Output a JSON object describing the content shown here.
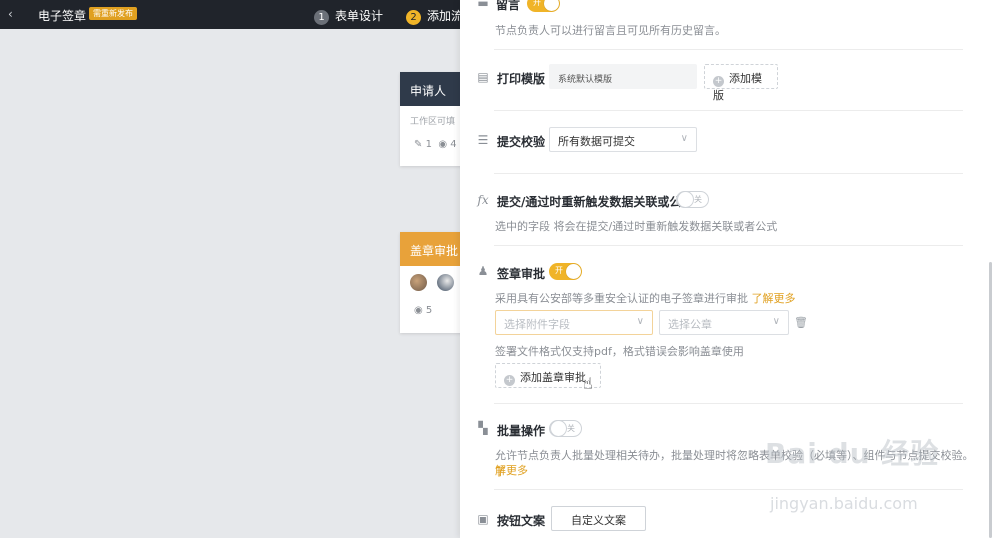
{
  "topbar": {
    "back_icon": "chevron-left-icon",
    "app_title": "电子签章",
    "badge": "需重新发布",
    "steps": [
      {
        "num": "1",
        "label": "表单设计"
      },
      {
        "num": "2",
        "label": "添加流"
      }
    ]
  },
  "canvas": {
    "applicant_node": {
      "title": "申请人",
      "subtitle": "工作区可填",
      "edit_count": "1",
      "view_count": "4"
    },
    "seal_node": {
      "title": "盖章审批",
      "view_count": "5"
    }
  },
  "panel": {
    "comment": {
      "title": "留言",
      "toggle": "开",
      "desc": "节点负责人可以进行留言且可见所有历史留言。"
    },
    "print": {
      "title": "打印模版",
      "template_value": "系统默认模版",
      "add_label": "添加模版"
    },
    "submit_check": {
      "title": "提交校验",
      "select_value": "所有数据可提交"
    },
    "retrigger": {
      "icon_text": "fx",
      "title": "提交/通过时重新触发数据关联或公式",
      "toggle": "关",
      "desc": "选中的字段 将会在提交/通过时重新触发数据关联或者公式"
    },
    "seal": {
      "title": "签章审批",
      "toggle": "开",
      "desc": "采用具有公安部等多重安全认证的电子签章进行审批",
      "learn_more": "了解更多",
      "attachment_placeholder": "选择附件字段",
      "seal_placeholder": "选择公章",
      "note": "签署文件格式仅支持pdf，格式错误会影响盖章使用",
      "add_label": "添加盖章审批"
    },
    "batch": {
      "title": "批量操作",
      "toggle": "关",
      "desc": "允许节点负责人批量处理相关待办，批量处理时将忽略表单校验（必填等）、组件与节点提交校验。",
      "learn_more_1": "了",
      "learn_more_2": "解更多"
    },
    "button_text": {
      "title": "按钮文案",
      "custom_label": "自定义文案"
    }
  },
  "watermark": {
    "main": "Bai du 经验",
    "sub": "jingyan.baidu.com"
  },
  "colors": {
    "accent": "#f0b428",
    "topbar": "#20242b",
    "applicant_head": "#2f3a4a",
    "seal_head": "#e8a23a"
  }
}
